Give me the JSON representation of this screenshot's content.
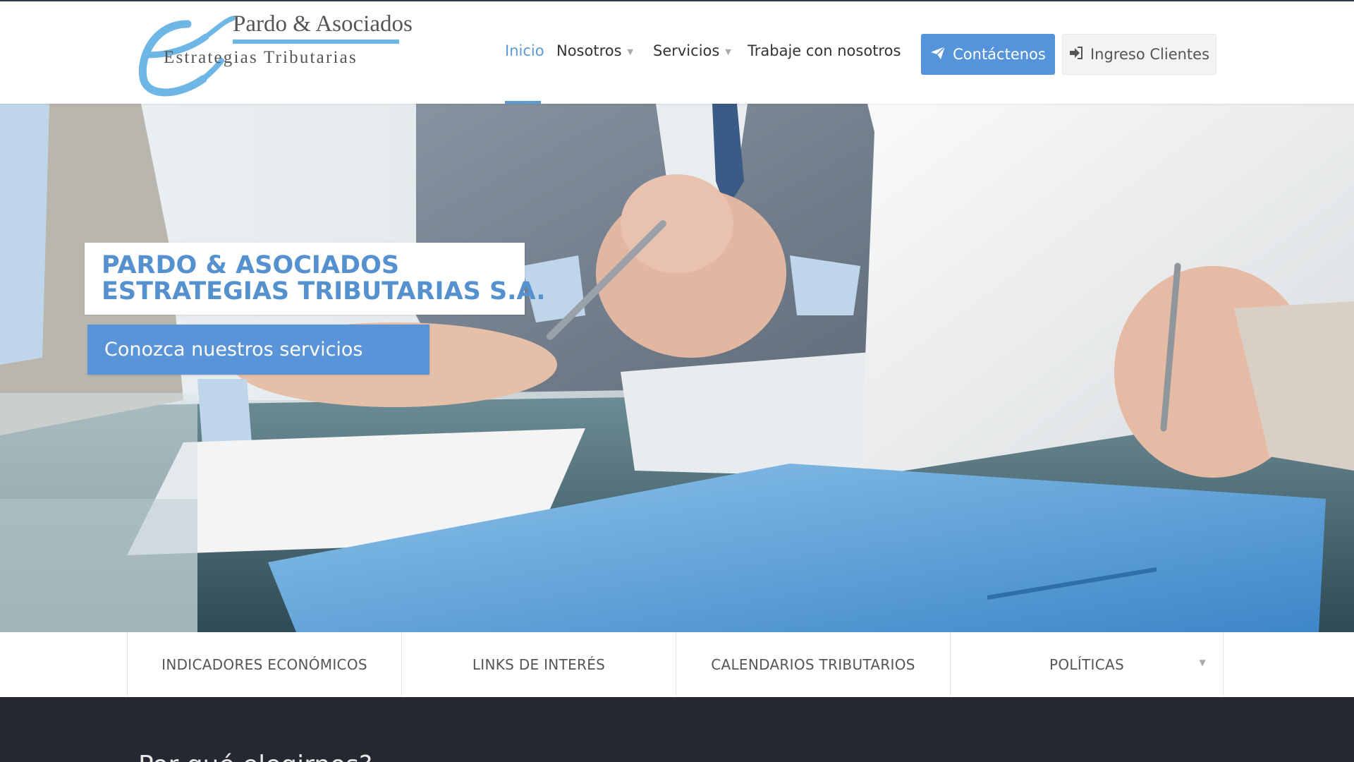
{
  "logo": {
    "name": "Pardo & Asociados",
    "tagline": "Estrategias Tributarias"
  },
  "nav": {
    "items": [
      {
        "label": "Inicio",
        "active": true
      },
      {
        "label": "Nosotros",
        "has_dropdown": true
      },
      {
        "label": "Servicios",
        "has_dropdown": true
      },
      {
        "label": "Trabaje con nosotros"
      }
    ],
    "contact_label": "Contáctenos",
    "login_label": "Ingreso Clientes"
  },
  "hero": {
    "title_line1": "PARDO & ASOCIADOS",
    "title_line2": "ESTRATEGIAS TRIBUTARIAS S.A.",
    "cta_label": "Conozca nuestros servicios"
  },
  "tabs": [
    {
      "label": "INDICADORES ECONÓMICOS"
    },
    {
      "label": "LINKS DE INTERÉS"
    },
    {
      "label": "CALENDARIOS TRIBUTARIOS"
    },
    {
      "label": "POLÍTICAS",
      "has_dropdown": true
    }
  ],
  "dark_section": {
    "heading": "Por qué elegirnos?"
  },
  "colors": {
    "accent": "#5c9ad6",
    "button_primary": "#5593da",
    "title_blue": "#5590cf",
    "dark_bg": "#252830"
  },
  "icons": {
    "contact": "paper-plane-icon",
    "login": "sign-in-icon",
    "dropdown": "caret-down-icon"
  }
}
